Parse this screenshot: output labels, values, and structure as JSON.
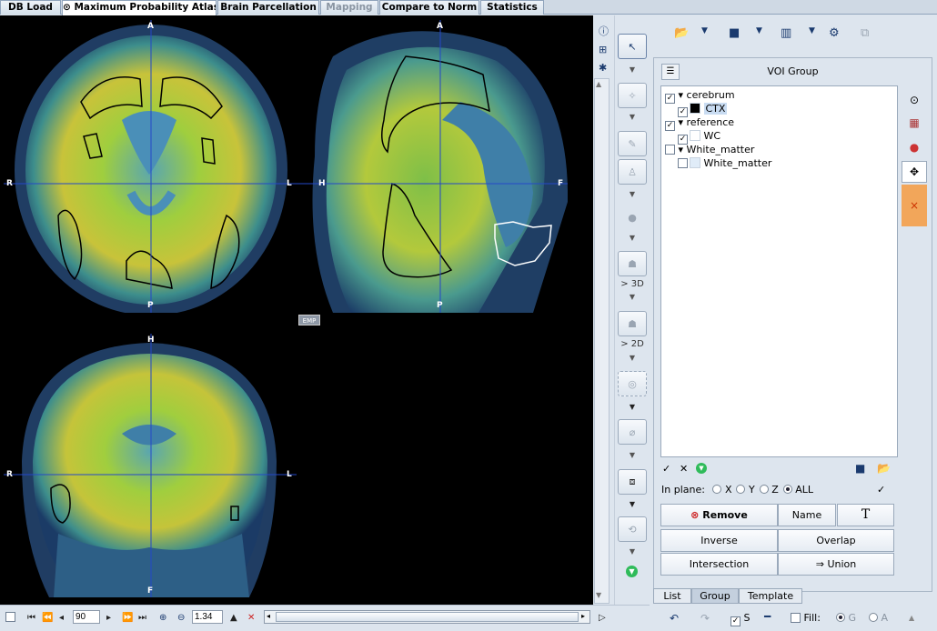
{
  "tabs": [
    {
      "label": "DB Load",
      "state": "normal"
    },
    {
      "label": "Maximum Probability Atlas",
      "state": "active",
      "icon": "radio-icon"
    },
    {
      "label": "Brain Parcellation",
      "state": "normal"
    },
    {
      "label": "Mapping",
      "state": "disabled"
    },
    {
      "label": "Compare to Norm",
      "state": "normal"
    },
    {
      "label": "Statistics",
      "state": "normal"
    }
  ],
  "viewer": {
    "axial": {
      "top": "A",
      "bottom": "P",
      "left": "R",
      "right": "L"
    },
    "sagittal": {
      "top": "A",
      "bottom": "P",
      "left": "H",
      "right": "F"
    },
    "coronal": {
      "top": "H",
      "bottom": "F",
      "left": "R",
      "right": "L"
    },
    "emp_badge": "EMP"
  },
  "tools": {
    "label_3d": "> 3D",
    "label_2d": "> 2D"
  },
  "voi_group": {
    "title": "VOI Group",
    "tree": [
      {
        "label": "cerebrum",
        "type": "group",
        "checked": true,
        "indent": 0
      },
      {
        "label": "CTX",
        "type": "voi",
        "checked": true,
        "color": "#000000",
        "indent": 1,
        "selected": true
      },
      {
        "label": "reference",
        "type": "group",
        "checked": true,
        "indent": 0
      },
      {
        "label": "WC",
        "type": "voi",
        "checked": true,
        "color": "#ffffff",
        "indent": 1
      },
      {
        "label": "White_matter",
        "type": "group",
        "checked": false,
        "indent": 0
      },
      {
        "label": "White_matter",
        "type": "voi",
        "checked": false,
        "color": "#e0ecf8",
        "indent": 1
      }
    ],
    "in_plane_label": "In plane:",
    "in_plane_options": [
      "X",
      "Y",
      "Z",
      "ALL"
    ],
    "in_plane_selected": "ALL",
    "buttons": {
      "remove": "Remove",
      "name": "Name",
      "text": "T",
      "inverse": "Inverse",
      "overlap": "Overlap",
      "intersection": "Intersection",
      "union": "Union"
    }
  },
  "bottom_tabs": [
    "List",
    "Group",
    "Template"
  ],
  "active_bottom_tab": "Group",
  "status": {
    "slice": "90",
    "zoom": "1.34",
    "s_label": "S",
    "fill_label": "Fill:",
    "g_label": "G",
    "a_label": "A"
  }
}
